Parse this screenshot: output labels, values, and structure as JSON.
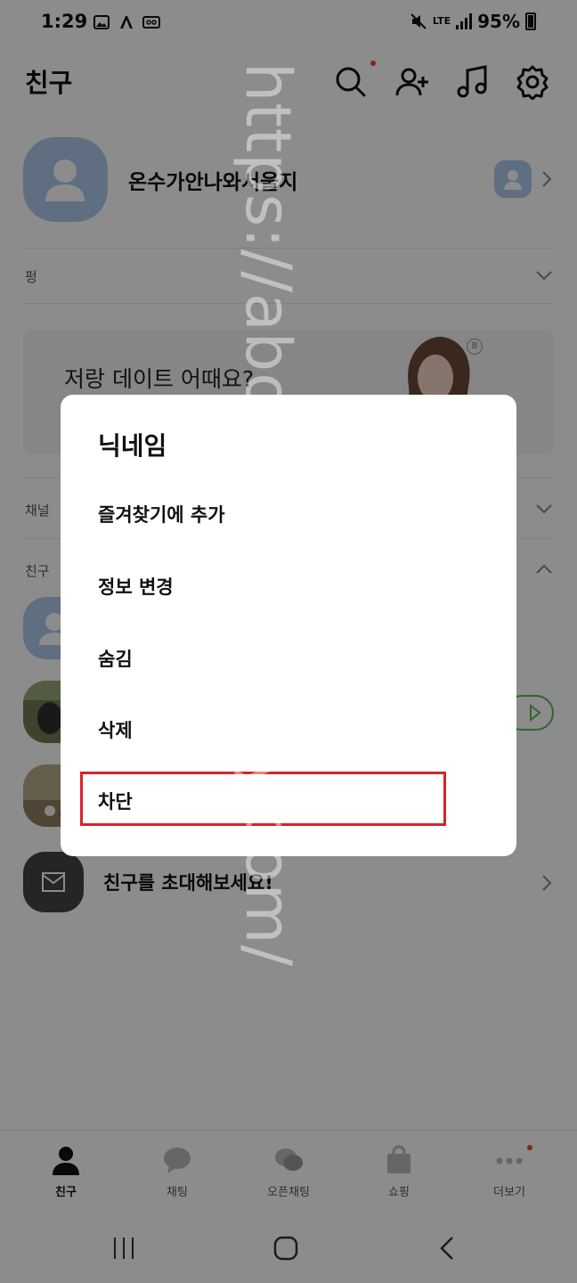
{
  "status_bar": {
    "time": "1:29",
    "network": "LTE",
    "battery": "95%"
  },
  "header": {
    "title": "친구"
  },
  "profile": {
    "name": "온수가안나와서울지"
  },
  "sections": {
    "pyeong": "펑",
    "channel": "채널",
    "friends": "친구"
  },
  "banner": {
    "text": "저랑 데이트 어때요?"
  },
  "invite": {
    "label": "친구를 초대해보세요!"
  },
  "tabs": [
    {
      "label": "친구",
      "icon": "person-icon",
      "active": true
    },
    {
      "label": "채팅",
      "icon": "chat-icon",
      "active": false
    },
    {
      "label": "오픈채팅",
      "icon": "open-chat-icon",
      "active": false
    },
    {
      "label": "쇼핑",
      "icon": "shopping-bag-icon",
      "active": false
    },
    {
      "label": "더보기",
      "icon": "more-icon",
      "active": false
    }
  ],
  "dialog": {
    "title": "닉네임",
    "items": [
      "즐겨찾기에 추가",
      "정보 변경",
      "숨김",
      "삭제",
      "차단"
    ],
    "highlighted_item": "차단"
  },
  "watermark": "https://abocoffe.tistory.com/",
  "colors": {
    "accent_red": "#d8232a",
    "notification_dot": "#e84a2a",
    "avatar_blue": "#aec9ec",
    "play_green": "#5cb85c"
  }
}
